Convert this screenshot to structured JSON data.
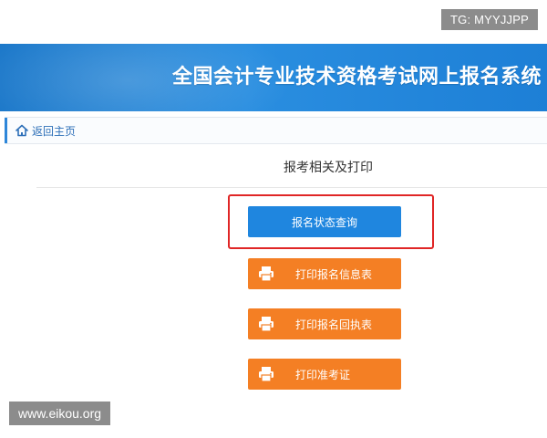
{
  "watermarks": {
    "top": "TG: MYYJJPP",
    "bottom": "www.eikou.org"
  },
  "banner": {
    "title": "全国会计专业技术资格考试网上报名系统"
  },
  "breadcrumb": {
    "home_label": "返回主页"
  },
  "main": {
    "section_title": "报考相关及打印",
    "buttons": {
      "status_query": "报名状态查询",
      "print_registration_info": "打印报名信息表",
      "print_registration_receipt": "打印报名回执表",
      "print_admission_ticket": "打印准考证"
    }
  },
  "icons": {
    "home": "home-icon",
    "printer": "printer-icon"
  },
  "colors": {
    "banner_blue": "#1f7fd4",
    "button_blue": "#1f86df",
    "button_orange": "#f47f24",
    "highlight_red": "#e02626",
    "link_blue": "#2d6fb8"
  }
}
